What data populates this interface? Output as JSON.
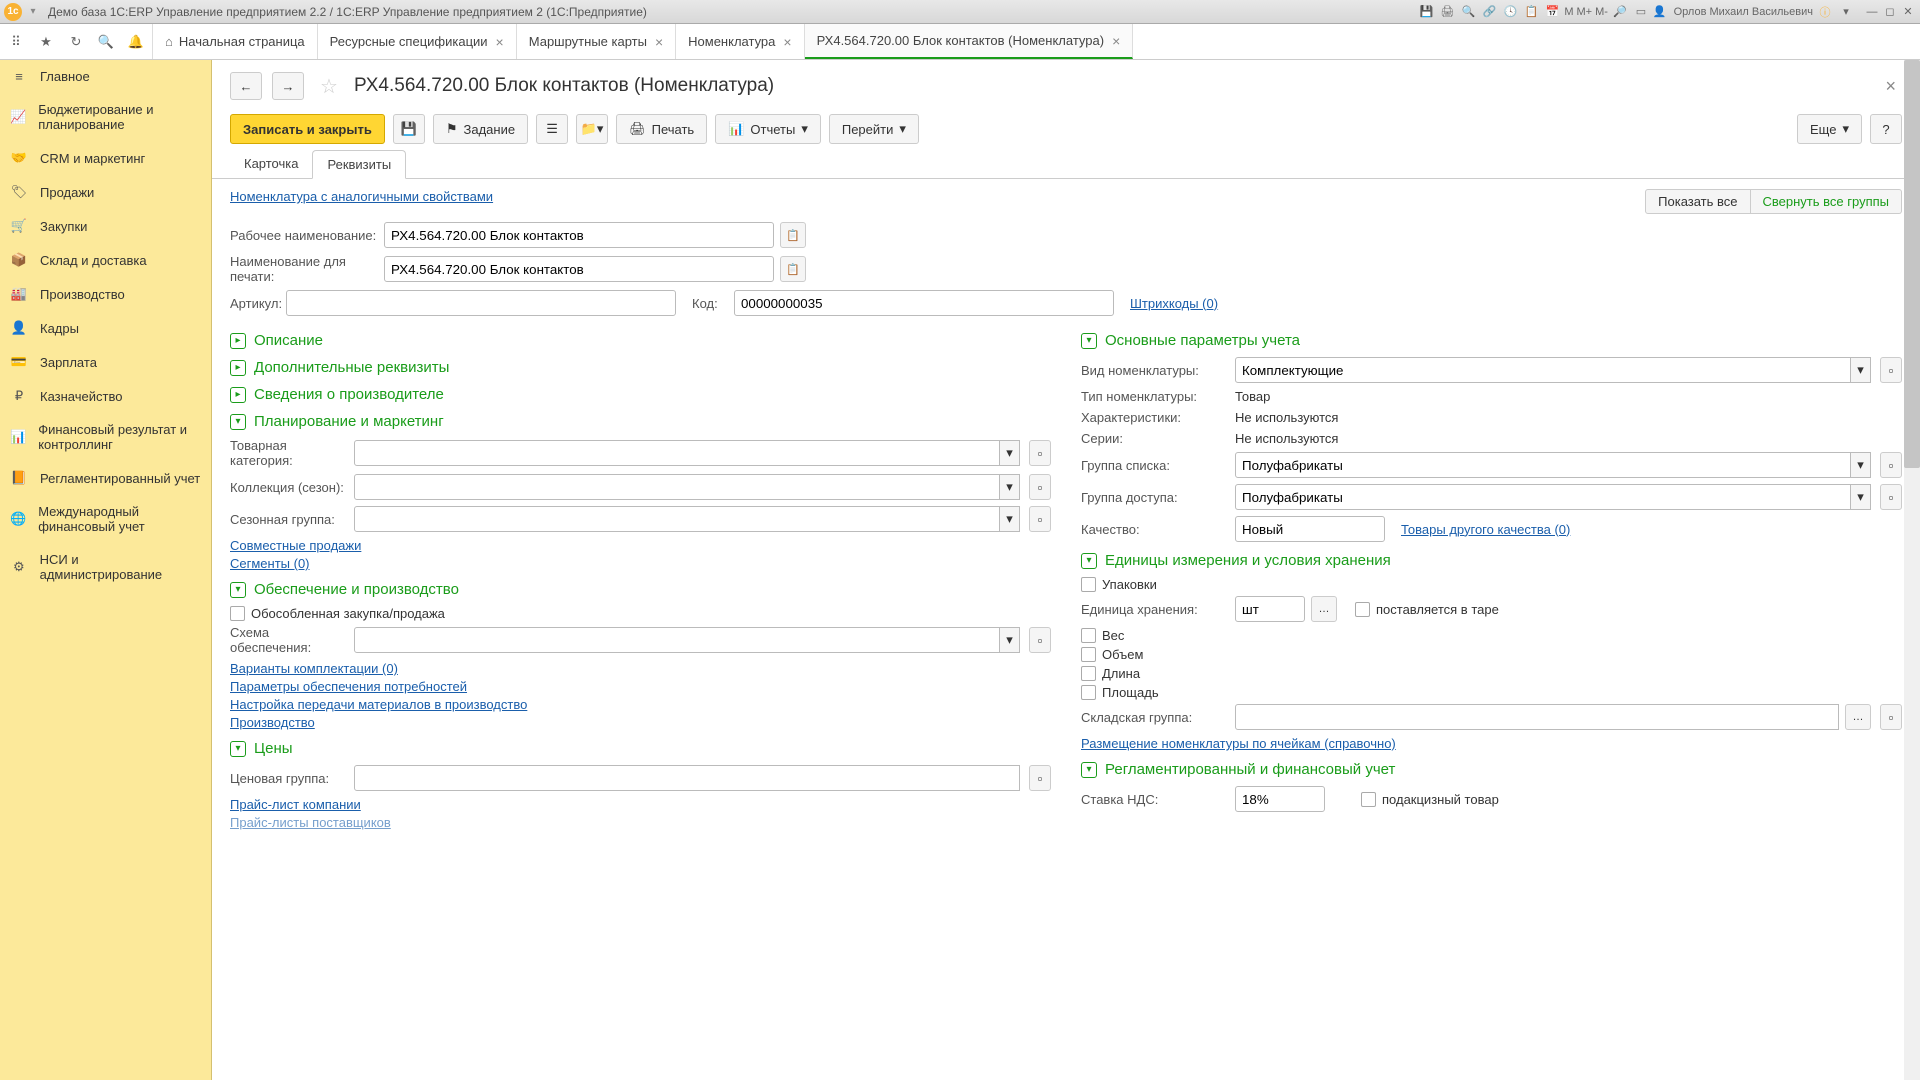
{
  "titlebar": {
    "title": "Демо база 1C:ERP Управление предприятием 2.2 / 1C:ERP Управление предприятием 2 (1С:Предприятие)",
    "user": "Орлов Михаил Васильевич",
    "m1": "M",
    "m2": "M+",
    "m3": "M-"
  },
  "tabs": {
    "home": "Начальная страница",
    "t1": "Ресурсные спецификации",
    "t2": "Маршрутные карты",
    "t3": "Номенклатура",
    "t4": "РХ4.564.720.00 Блок контактов (Номенклатура)"
  },
  "sidebar": {
    "items": [
      {
        "label": "Главное"
      },
      {
        "label": "Бюджетирование и планирование"
      },
      {
        "label": "CRM и маркетинг"
      },
      {
        "label": "Продажи"
      },
      {
        "label": "Закупки"
      },
      {
        "label": "Склад и доставка"
      },
      {
        "label": "Производство"
      },
      {
        "label": "Кадры"
      },
      {
        "label": "Зарплата"
      },
      {
        "label": "Казначейство"
      },
      {
        "label": "Финансовый результат и контроллинг"
      },
      {
        "label": "Регламентированный учет"
      },
      {
        "label": "Международный финансовый учет"
      },
      {
        "label": "НСИ и администрирование"
      }
    ]
  },
  "page": {
    "title": "РХ4.564.720.00 Блок контактов (Номенклатура)"
  },
  "toolbar": {
    "save_close": "Записать и закрыть",
    "task": "Задание",
    "print": "Печать",
    "reports": "Отчеты",
    "goto": "Перейти",
    "more": "Еще",
    "help": "?"
  },
  "subtabs": {
    "card": "Карточка",
    "req": "Реквизиты"
  },
  "form": {
    "similar_link": "Номенклатура с аналогичными свойствами",
    "show_all": "Показать все",
    "collapse_all": "Свернуть все группы",
    "work_name_label": "Рабочее наименование:",
    "work_name": "РХ4.564.720.00 Блок контактов",
    "print_name_label": "Наименование для печати:",
    "print_name": "РХ4.564.720.00 Блок контактов",
    "article_label": "Артикул:",
    "article": "",
    "code_label": "Код:",
    "code": "00000000035",
    "barcodes_link": "Штрихкоды (0)"
  },
  "groups": {
    "description": "Описание",
    "extra": "Дополнительные реквизиты",
    "manufacturer": "Сведения о производителе",
    "planning": "Планирование и маркетинг",
    "supply": "Обеспечение и производство",
    "prices": "Цены",
    "accounting": "Основные параметры учета",
    "units": "Единицы измерения и условия хранения",
    "regulated": "Регламентированный и финансовый учет"
  },
  "left": {
    "category_label": "Товарная категория:",
    "collection_label": "Коллекция (сезон):",
    "season_label": "Сезонная группа:",
    "joint_sales": "Совместные продажи",
    "segments": "Сегменты (0)",
    "isolated_label": "Обособленная закупка/продажа",
    "scheme_label": "Схема обеспечения:",
    "variants": "Варианты комплектации (0)",
    "params": "Параметры обеспечения потребностей",
    "transfer": "Настройка передачи материалов в производство",
    "production": "Производство",
    "price_group_label": "Ценовая группа:",
    "price_list": "Прайс-лист компании",
    "price_list2": "Прайс-листы поставщиков"
  },
  "right": {
    "type_label": "Вид номенклатуры:",
    "type": "Комплектующие",
    "nom_type_label": "Тип номенклатуры:",
    "nom_type": "Товар",
    "char_label": "Характеристики:",
    "char": "Не используются",
    "series_label": "Серии:",
    "series": "Не используются",
    "list_group_label": "Группа списка:",
    "list_group": "Полуфабрикаты",
    "access_group_label": "Группа доступа:",
    "access_group": "Полуфабрикаты",
    "quality_label": "Качество:",
    "quality": "Новый",
    "other_quality": "Товары другого качества (0)",
    "packaging": "Упаковки",
    "storage_unit_label": "Единица хранения:",
    "storage_unit": "шт",
    "in_container": "поставляется в таре",
    "weight": "Вес",
    "volume": "Объем",
    "length": "Длина",
    "area": "Площадь",
    "warehouse_label": "Складская группа:",
    "placement": "Размещение номенклатуры по ячейкам (справочно)",
    "vat_label": "Ставка НДС:",
    "vat": "18%",
    "excise": "подакцизный товар"
  }
}
